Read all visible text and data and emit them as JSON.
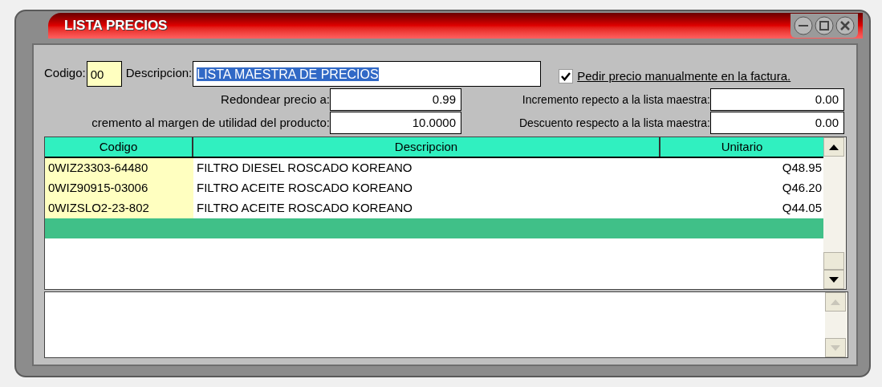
{
  "window": {
    "title": "LISTA PRECIOS"
  },
  "form": {
    "codigo_label": "Codigo:",
    "codigo_value": "00",
    "descripcion_label": "Descripcion:",
    "descripcion_value": "LISTA MAESTRA DE PRECIOS",
    "manual_price": {
      "label": "Pedir precio manualmente en la factura.",
      "checked": true
    },
    "fields": [
      {
        "label": "Redondear precio a:",
        "value": "0.99"
      },
      {
        "label": "Incremento repecto a la lista maestra:",
        "value": "0.00"
      },
      {
        "label": "cremento al margen de utilidad del producto:",
        "value": "10.0000"
      },
      {
        "label": "Descuento respecto a la lista maestra:",
        "value": "0.00"
      }
    ]
  },
  "table": {
    "columns": [
      "Codigo",
      "Descripcion",
      "Unitario"
    ],
    "rows": [
      {
        "codigo": "0WIZ23303-64480",
        "descripcion": "FILTRO DIESEL ROSCADO KOREANO",
        "unitario": "Q48.95",
        "selected": false
      },
      {
        "codigo": "0WIZ90915-03006",
        "descripcion": "FILTRO ACEITE ROSCADO KOREANO",
        "unitario": "Q46.20",
        "selected": false
      },
      {
        "codigo": "0WIZSLO2-23-802",
        "descripcion": "FILTRO ACEITE ROSCADO KOREANO",
        "unitario": "Q44.05",
        "selected": false
      }
    ],
    "new_row": {
      "selected": true
    }
  }
}
